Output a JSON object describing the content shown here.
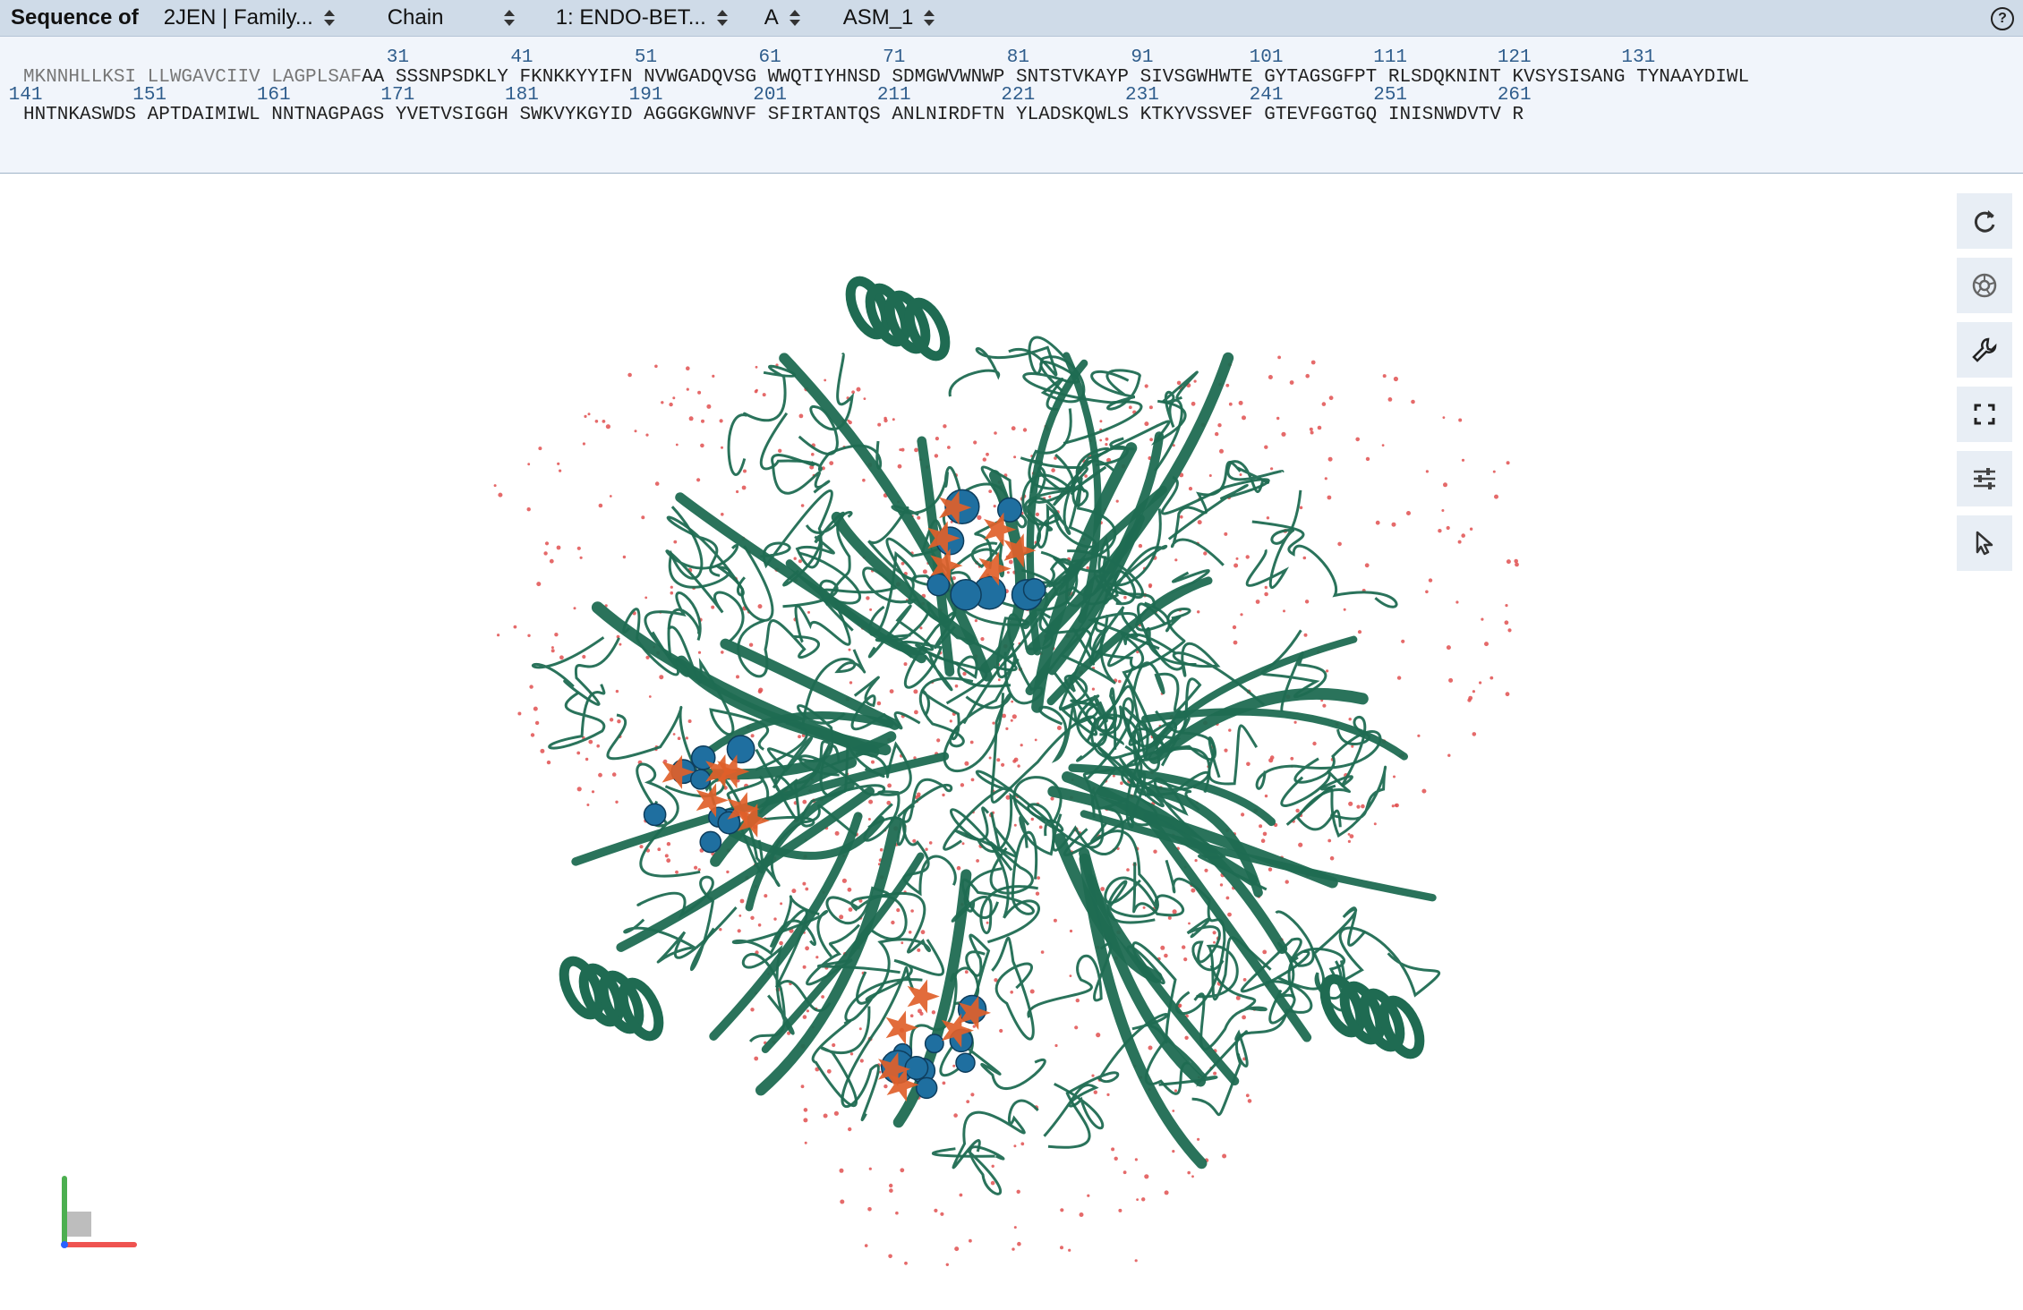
{
  "header": {
    "title": "Sequence of",
    "entry_select": "2JEN | Family...",
    "mode_select": "Chain",
    "entity_select": "1: ENDO-BET...",
    "chain_select": "A",
    "assembly_select": "ASM_1",
    "help": "?"
  },
  "sequence": {
    "line1_numbers": [
      "31",
      "41",
      "51",
      "61",
      "71",
      "81",
      "91",
      "101",
      "111",
      "121",
      "131"
    ],
    "line1_muted": "MKNNHLLKSI LLWGAVCIIV LAGPLSAF",
    "line1_rest": "AA SSSNPSDKLY FKNKKYYIFN NVWGADQVSG WWQTIYHNSD SDMGWVWNWP SNTSTVKAYP SIVSGWHWTE GYTAGSGFPT RLSDQKNINT KVSYSISANG TYNAAYDIWL",
    "line2_numbers": [
      "141",
      "151",
      "161",
      "171",
      "181",
      "191",
      "201",
      "211",
      "221",
      "231",
      "241",
      "251",
      "261"
    ],
    "line2": "HNTNKASWDS APTDAIMIWL NNTNAGPAGS YVETVSIGGH SWKVYKGYID AGGGKGWNVF SFIRTANTQS ANLNIRDFTN YLADSKQWLS KTKYVSSVEF GTEVFGGTGQ INISNWDVTV R"
  },
  "toolbar": {
    "icons": [
      "reset-icon",
      "screenshot-icon",
      "tools-icon",
      "fullscreen-icon",
      "settings-icon",
      "select-icon"
    ]
  },
  "colors": {
    "ribbon": "#1f6b52",
    "ligand_blue": "#1f6fa0",
    "ligand_orange": "#e0602a",
    "water": "#e05050"
  }
}
